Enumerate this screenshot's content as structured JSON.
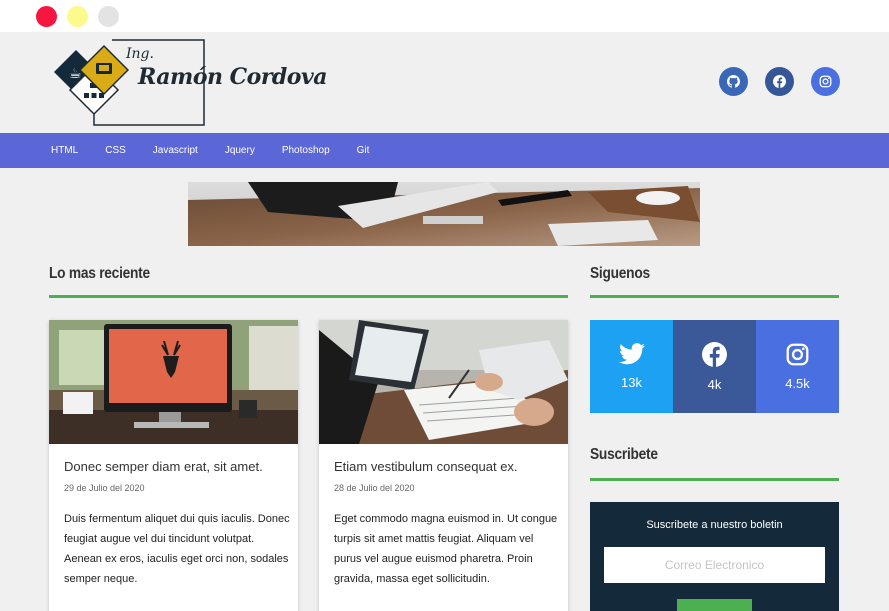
{
  "header": {
    "logo_prefix": "Ing.",
    "logo_name": "Ramón Cordova",
    "social_icons": [
      "github-icon",
      "facebook-icon",
      "instagram-icon"
    ]
  },
  "nav": {
    "items": [
      "HTML",
      "CSS",
      "Javascript",
      "Jquery",
      "Photoshop",
      "Git"
    ]
  },
  "main": {
    "section_title": "Lo mas reciente",
    "posts": [
      {
        "title": "Donec semper diam erat, sit amet.",
        "date": "29 de Julio del 2020",
        "excerpt": "Duis fermentum aliquet dui quis iaculis. Donec feugiat augue vel dui tincidunt volutpat. Aenean ex eros, iaculis eget orci non, sodales semper neque."
      },
      {
        "title": "Etiam vestibulum consequat ex.",
        "date": "28 de Julio del 2020",
        "excerpt": "Eget commodo magna euismod in. Ut congue turpis sit amet mattis feugiat. Aliquam vel purus vel augue euismod pharetra. Proin gravida, massa eget sollicitudin."
      }
    ]
  },
  "sidebar": {
    "follow_title": "Siguenos",
    "social_counts": [
      {
        "icon": "twitter-icon",
        "count": "13k",
        "color": "#1da1f2"
      },
      {
        "icon": "facebook-icon",
        "count": "4k",
        "color": "#3b5998"
      },
      {
        "icon": "instagram-icon",
        "count": "4.5k",
        "color": "#4a6fe0"
      }
    ],
    "subscribe_title": "Suscribete",
    "newsletter": {
      "heading": "Suscribete a nuestro boletin",
      "placeholder": "Correo Electronico"
    }
  },
  "colors": {
    "nav": "#5b67d6",
    "accent": "#4cb050",
    "newsletter_bg": "#14293a"
  }
}
